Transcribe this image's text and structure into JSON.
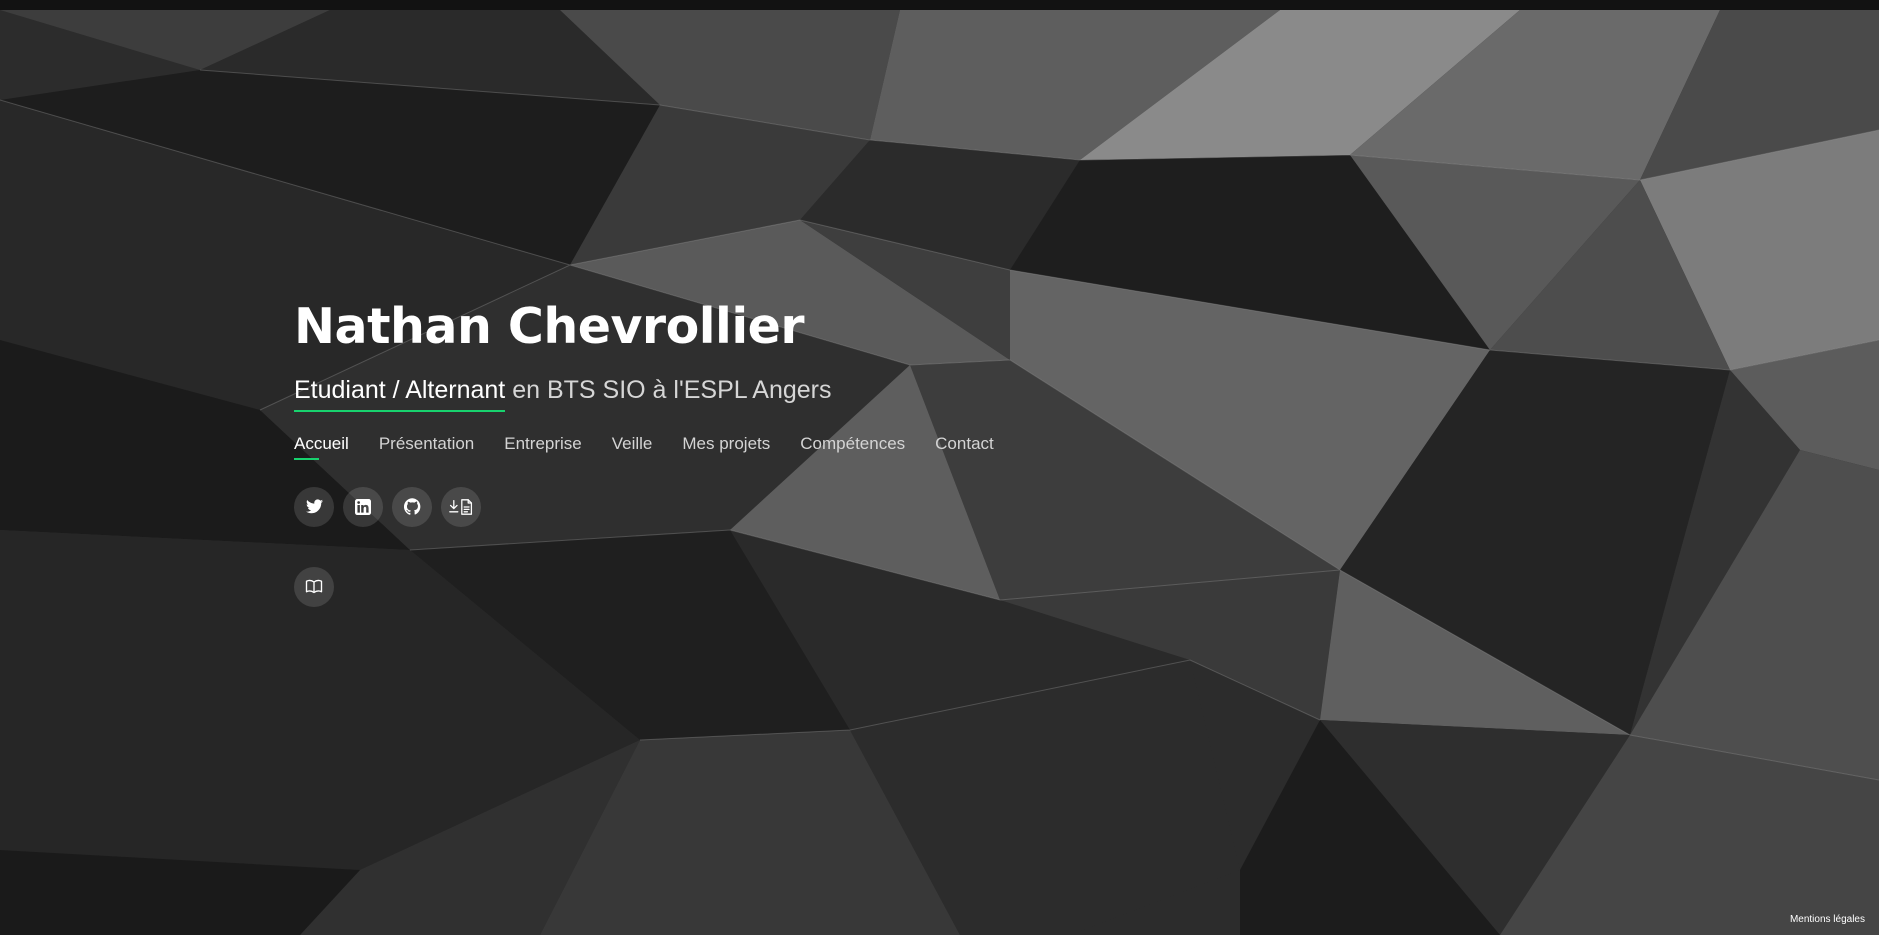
{
  "hero": {
    "name": "Nathan Chevrollier",
    "subtitle_typed": "Etudiant / Alternant",
    "subtitle_rest": " en BTS SIO à l'ESPL Angers"
  },
  "nav": {
    "items": [
      {
        "label": "Accueil",
        "active": true
      },
      {
        "label": "Présentation"
      },
      {
        "label": "Entreprise"
      },
      {
        "label": "Veille"
      },
      {
        "label": "Mes projets"
      },
      {
        "label": "Compétences"
      },
      {
        "label": "Contact"
      }
    ]
  },
  "socials": {
    "icons": [
      "twitter-icon",
      "linkedin-icon",
      "github-icon",
      "download-cv-icon"
    ]
  },
  "book": {
    "icon": "book-icon"
  },
  "footer": {
    "legal": "Mentions légales"
  },
  "colors": {
    "accent": "#18d26e",
    "text": "#ffffff",
    "icon_bg": "rgba(255,255,255,0.13)"
  }
}
